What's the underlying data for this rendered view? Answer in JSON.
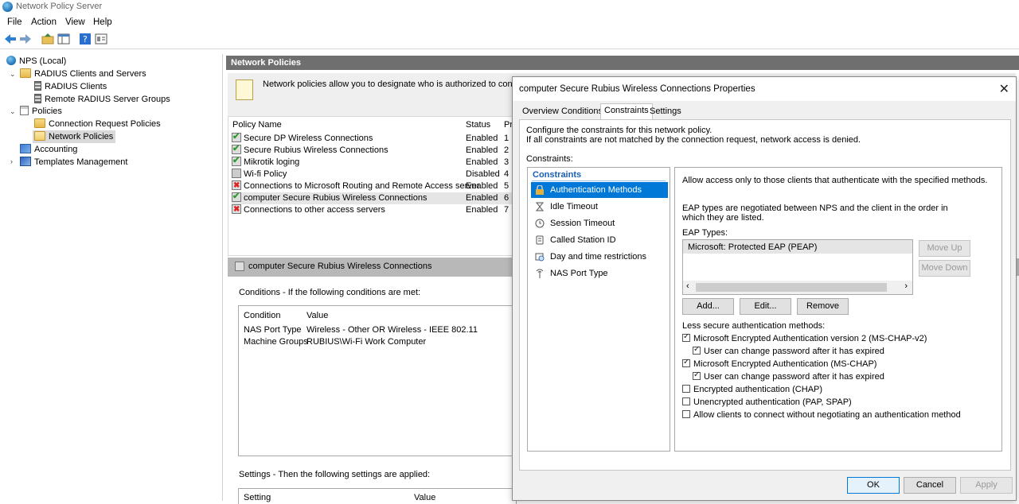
{
  "window": {
    "title": "Network Policy Server"
  },
  "menu": [
    "File",
    "Action",
    "View",
    "Help"
  ],
  "tree": {
    "root": "NPS (Local)",
    "radius_clients_servers": "RADIUS Clients and Servers",
    "radius_clients": "RADIUS Clients",
    "remote_groups": "Remote RADIUS Server Groups",
    "policies": "Policies",
    "connection_request_policies": "Connection Request Policies",
    "network_policies": "Network Policies",
    "accounting": "Accounting",
    "templates": "Templates Management"
  },
  "main": {
    "header": "Network Policies",
    "info_text": "Network policies allow you to designate who is authorized to connect to the",
    "columns": {
      "name": "Policy Name",
      "status": "Status",
      "order": "Pr"
    },
    "policies": [
      {
        "name": "Secure DP Wireless Connections",
        "status": "Enabled",
        "order": "1",
        "icon": "ok"
      },
      {
        "name": "Secure Rubius Wireless Connections",
        "status": "Enabled",
        "order": "2",
        "icon": "ok"
      },
      {
        "name": "Mikrotik loging",
        "status": "Enabled",
        "order": "3",
        "icon": "ok"
      },
      {
        "name": "Wi-fi Policy",
        "status": "Disabled",
        "order": "4",
        "icon": "dis"
      },
      {
        "name": "Connections to Microsoft Routing and Remote Access server",
        "status": "Enabled",
        "order": "5",
        "icon": "no"
      },
      {
        "name": "computer Secure Rubius Wireless Connections",
        "status": "Enabled",
        "order": "6",
        "icon": "ok"
      },
      {
        "name": "Connections to other access servers",
        "status": "Enabled",
        "order": "7",
        "icon": "no"
      }
    ],
    "detail_title": "computer Secure Rubius Wireless Connections",
    "conditions_caption": "Conditions - If the following conditions are met:",
    "cond_columns": {
      "condition": "Condition",
      "value": "Value"
    },
    "conditions": [
      {
        "condition": "NAS Port Type",
        "value": "Wireless - Other OR Wireless - IEEE 802.11"
      },
      {
        "condition": "Machine Groups",
        "value": "RUBIUS\\Wi-Fi Work Computer"
      }
    ],
    "settings_caption": "Settings - Then the following settings are applied:",
    "settings_columns": {
      "setting": "Setting",
      "value": "Value"
    }
  },
  "dialog": {
    "title": "computer Secure Rubius Wireless Connections Properties",
    "tabs": [
      "Overview",
      "Conditions",
      "Constraints",
      "Settings"
    ],
    "active_tab": "Constraints",
    "intro_line1": "Configure the constraints for this network policy.",
    "intro_line2": "If all constraints are not matched by the connection request, network access is denied.",
    "constraints_label": "Constraints:",
    "constraints_group": "Constraints",
    "constraints": [
      "Authentication Methods",
      "Idle Timeout",
      "Session Timeout",
      "Called Station ID",
      "Day and time restrictions",
      "NAS Port Type"
    ],
    "right": {
      "allow_text": "Allow access only to those clients that authenticate with the specified methods.",
      "eap_order_text": "EAP types are negotiated between NPS and the client in the order in which they are listed.",
      "eap_types_label": "EAP Types:",
      "eap_types": [
        "Microsoft: Protected EAP (PEAP)"
      ],
      "move_up": "Move Up",
      "move_down": "Move Down",
      "add": "Add...",
      "edit": "Edit...",
      "remove": "Remove",
      "less_secure_label": "Less secure authentication methods:",
      "methods": [
        {
          "label": "Microsoft Encrypted Authentication version 2 (MS-CHAP-v2)",
          "checked": true,
          "indent": false
        },
        {
          "label": "User can change password after it has expired",
          "checked": true,
          "indent": true
        },
        {
          "label": "Microsoft Encrypted Authentication (MS-CHAP)",
          "checked": true,
          "indent": false
        },
        {
          "label": "User can change password after it has expired",
          "checked": true,
          "indent": true
        },
        {
          "label": "Encrypted authentication (CHAP)",
          "checked": false,
          "indent": false
        },
        {
          "label": "Unencrypted authentication (PAP, SPAP)",
          "checked": false,
          "indent": false
        },
        {
          "label": "Allow clients to connect without negotiating an authentication method",
          "checked": false,
          "indent": false
        }
      ]
    },
    "ok": "OK",
    "cancel": "Cancel",
    "apply": "Apply"
  }
}
